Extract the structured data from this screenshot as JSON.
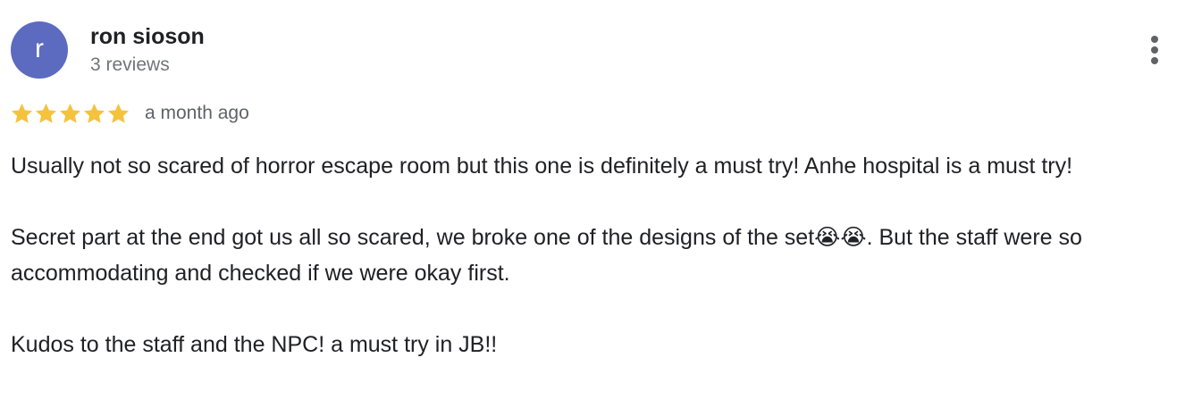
{
  "review": {
    "author": {
      "initial": "r",
      "name": "ron sioson",
      "meta": "3 reviews",
      "avatar_color": "#5c6bc0"
    },
    "menu_icon": "more-vert-icon",
    "rating": {
      "stars": 5,
      "max": 5,
      "star_icon": "star-icon",
      "star_color": "#f5c33b"
    },
    "time": "a month ago",
    "paragraphs": [
      "Usually not so scared of horror escape room but this one is definitely a must try! Anhe hospital is a must try!",
      "Secret part at the end got us all so scared, we broke one of the designs of the set😭😭. But the staff were so accommodating and checked if we were okay first.",
      "Kudos to the staff and the NPC! a must try in JB!!"
    ]
  }
}
